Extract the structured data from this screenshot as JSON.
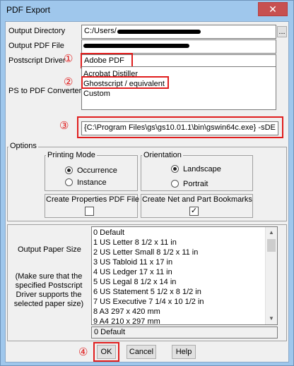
{
  "window": {
    "title": "PDF Export",
    "close_glyph": "✕"
  },
  "labels": {
    "output_directory": "Output Directory",
    "output_pdf_file": "Output PDF File",
    "postscript_driver": "Postscript Driver",
    "ps_to_pdf_converter": "PS to PDF Converter",
    "output_paper_size": "Output Paper Size",
    "paper_note": "(Make sure that the specified Postscript Driver supports the selected paper size)"
  },
  "fields": {
    "output_directory": "C:/Users/",
    "postscript_driver": "Adobe PDF",
    "converter_command": "{C:\\Program Files\\gs\\gs10.01.1\\bin\\gswin64c.exe} -sDE"
  },
  "browse_label": "...",
  "converter_list": [
    "Acrobat Distiller",
    "Ghostscript / equivalent",
    "Custom"
  ],
  "markers": [
    "①",
    "②",
    "③",
    "④"
  ],
  "options": {
    "title": "Options",
    "printing_mode": {
      "title": "Printing Mode",
      "occurrence": "Occurrence",
      "instance": "Instance",
      "selected": "Occurrence"
    },
    "orientation": {
      "title": "Orientation",
      "landscape": "Landscape",
      "portrait": "Portrait",
      "selected": "Landscape"
    },
    "create_properties": {
      "label": "Create Properties PDF File",
      "checked": false
    },
    "create_bookmarks": {
      "label": "Create Net and Part Bookmarks",
      "checked": true,
      "check_glyph": "✓"
    }
  },
  "paper_sizes": [
    "0 Default",
    "1 US Letter 8 1/2 x 11 in",
    "2 US Letter Small 8 1/2 x 11 in",
    "3 US Tabloid 11 x 17 in",
    "4 US Ledger 17 x 11 in",
    "5 US Legal 8 1/2 x 14 in",
    "6 US Statement 5 1/2 x 8 1/2 in",
    "7 US Executive 7 1/4 x 10 1/2 in",
    "8 A3 297 x 420 mm",
    "9 A4 210 x 297 mm"
  ],
  "paper_selected": "0 Default",
  "buttons": {
    "ok": "OK",
    "cancel": "Cancel",
    "help": "Help"
  },
  "colors": {
    "annotation": "#e01e1e",
    "title_bar": "#9fc7ec",
    "close": "#c75050"
  }
}
